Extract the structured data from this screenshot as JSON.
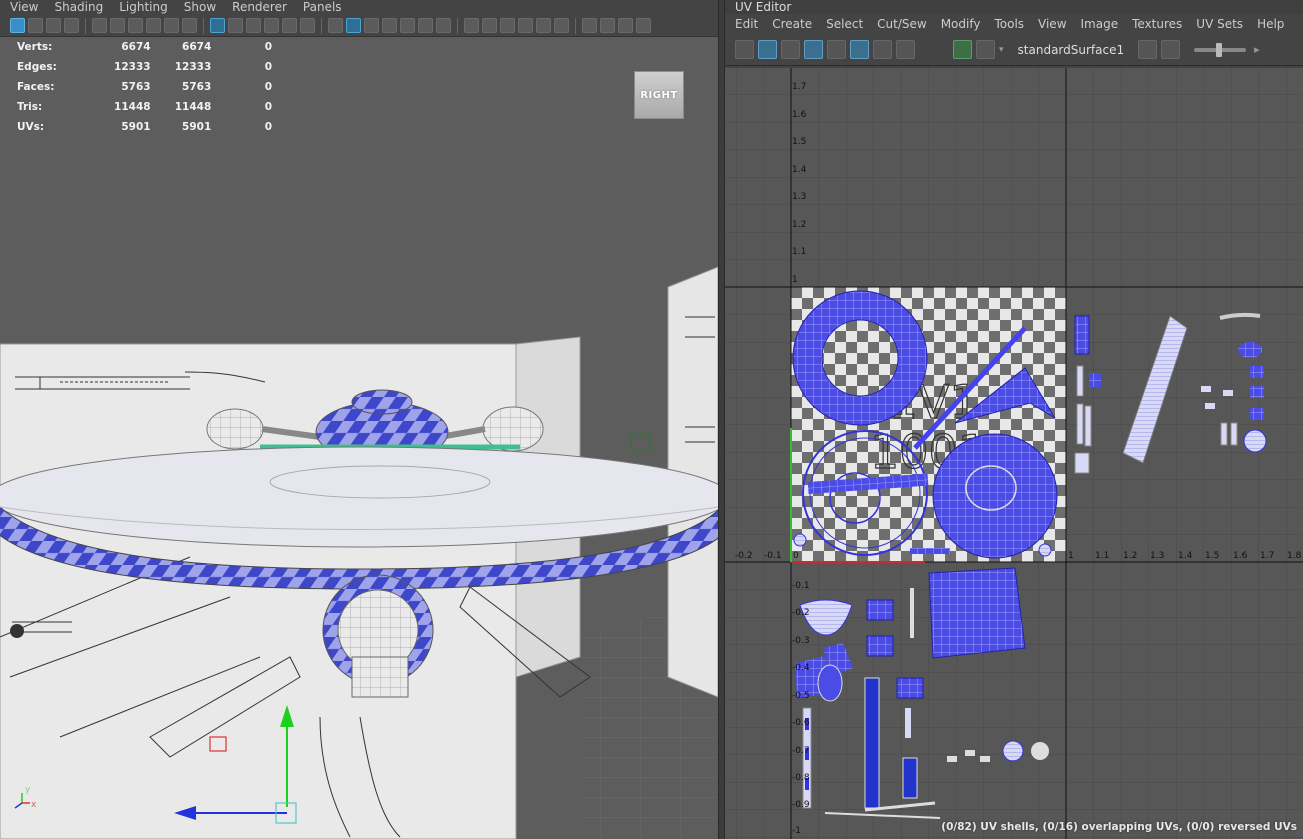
{
  "viewport": {
    "menu": [
      "View",
      "Shading",
      "Lighting",
      "Show",
      "Renderer",
      "Panels"
    ],
    "hud": [
      {
        "label": "Verts:",
        "a": "6674",
        "b": "6674",
        "c": "0"
      },
      {
        "label": "Edges:",
        "a": "12333",
        "b": "12333",
        "c": "0"
      },
      {
        "label": "Faces:",
        "a": "5763",
        "b": "5763",
        "c": "0"
      },
      {
        "label": "Tris:",
        "a": "11448",
        "b": "11448",
        "c": "0"
      },
      {
        "label": "UVs:",
        "a": "5901",
        "b": "5901",
        "c": "0"
      }
    ],
    "viewcube_label": "RIGHT",
    "axis_y": "y",
    "axis_x": "x"
  },
  "uv_editor": {
    "title": "UV Editor",
    "menu": [
      "Edit",
      "Create",
      "Select",
      "Cut/Sew",
      "Modify",
      "Tools",
      "View",
      "Image",
      "Textures",
      "UV Sets",
      "Help"
    ],
    "shader_name": "standardSurface1",
    "texture_text_top": "U1V1",
    "texture_text_bottom": "1001",
    "axis_v_labels": [
      "1.7",
      "1.6",
      "1.5",
      "1.4",
      "1.3",
      "1.2",
      "1.1",
      "1"
    ],
    "axis_u_labels": [
      "-0.2",
      "-0.1",
      "0",
      "1",
      "1.1",
      "1.2",
      "1.3",
      "1.4",
      "1.5",
      "1.6",
      "1.7",
      "1.8"
    ],
    "axis_v_neg_labels": [
      "-0.1",
      "-0.2",
      "-0.3",
      "-0.4",
      "-0.5",
      "-0.6",
      "-0.7",
      "-0.8",
      "-0.9",
      "-1"
    ],
    "status": "(0/82) UV shells, (0/16) overlapping UVs, (0/0) reversed UVs"
  },
  "colors": {
    "uv_shell": "#3333dd",
    "viewport_bg": "#5d5d5d",
    "uv_bg": "#575757",
    "accent": "#3a8ec7"
  }
}
